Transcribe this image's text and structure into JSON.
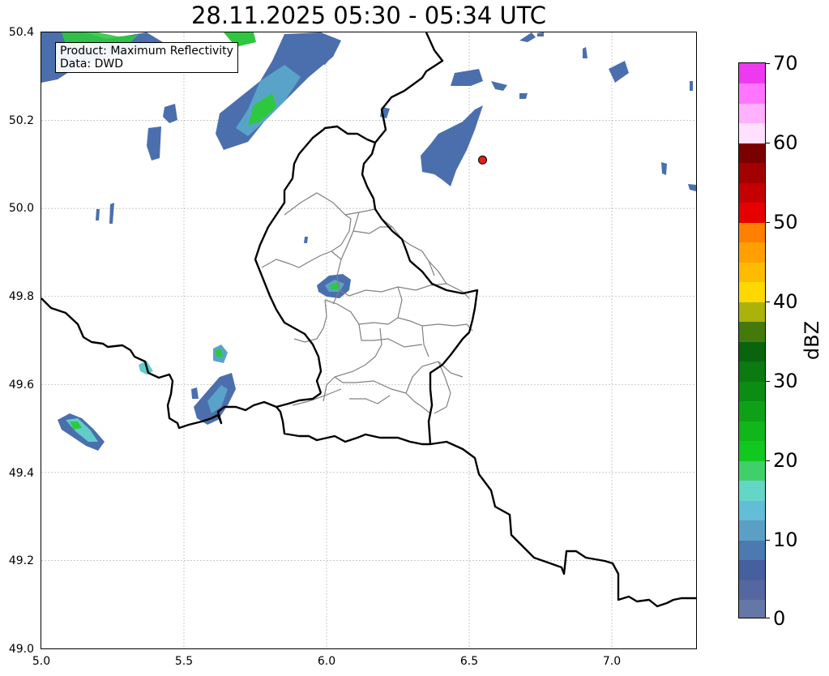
{
  "title": "28.11.2025 05:30 - 05:34 UTC",
  "info": {
    "product": "Product: Maximum Reflectivity",
    "source": "Data: DWD"
  },
  "axes": {
    "x_ticks": [
      "5.0",
      "5.5",
      "6.0",
      "6.5",
      "7.0"
    ],
    "y_ticks": [
      "50.4",
      "50.2",
      "50.0",
      "49.8",
      "49.6",
      "49.4",
      "49.2",
      "49.0"
    ],
    "xlim": [
      5.0,
      7.3
    ],
    "ylim": [
      49.0,
      50.4
    ],
    "grid": true
  },
  "colorbar": {
    "label": "dBZ",
    "ticks": [
      "0",
      "10",
      "20",
      "30",
      "40",
      "50",
      "60",
      "70"
    ],
    "range": [
      0,
      70
    ],
    "colors": [
      "#6577a6",
      "#5567a0",
      "#465f9f",
      "#4b79b0",
      "#5a9fc6",
      "#62bdd6",
      "#63d6c5",
      "#3fd06a",
      "#11c81e",
      "#11b61a",
      "#0ea117",
      "#0b8c14",
      "#0a7a11",
      "#0a640d",
      "#447a0c",
      "#aab20b",
      "#ffd800",
      "#ffbb00",
      "#ffa000",
      "#ff7f00",
      "#e60000",
      "#c40000",
      "#a30000",
      "#7a0000",
      "#ffe0ff",
      "#ffb0ff",
      "#ff75ff",
      "#ee3aee"
    ]
  },
  "marker": {
    "lon": 6.55,
    "lat": 50.11,
    "color": "#e02020"
  },
  "radar_colors": {
    "low": "#4b6fad",
    "mid": "#5aa3c8",
    "cyan": "#62cdc8",
    "green": "#2ec840",
    "bright_green": "#11c81e"
  }
}
